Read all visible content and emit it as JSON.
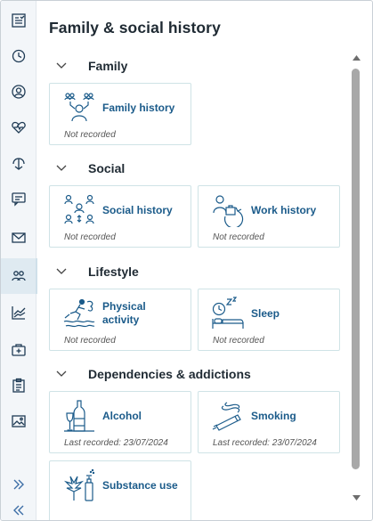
{
  "page": {
    "title": "Family & social history"
  },
  "sections": [
    {
      "label": "Family",
      "cards": [
        {
          "icon": "family-history-icon",
          "title": "Family history",
          "status": "Not recorded"
        }
      ]
    },
    {
      "label": "Social",
      "cards": [
        {
          "icon": "social-history-icon",
          "title": "Social history",
          "status": "Not recorded"
        },
        {
          "icon": "work-history-icon",
          "title": "Work history",
          "status": "Not recorded"
        }
      ]
    },
    {
      "label": "Lifestyle",
      "cards": [
        {
          "icon": "physical-activity-icon",
          "title": "Physical activity",
          "title_line1": "Physical",
          "title_line2": "activity",
          "status": "Not recorded"
        },
        {
          "icon": "sleep-icon",
          "title": "Sleep",
          "status": "Not recorded"
        }
      ]
    },
    {
      "label": "Dependencies & addictions",
      "cards": [
        {
          "icon": "alcohol-icon",
          "title": "Alcohol",
          "status": "Last recorded: 23/07/2024"
        },
        {
          "icon": "smoking-icon",
          "title": "Smoking",
          "status": "Last recorded: 23/07/2024"
        },
        {
          "icon": "substance-use-icon",
          "title": "Substance use",
          "status": ""
        }
      ]
    }
  ],
  "rail": {
    "items": [
      "summary-icon",
      "history-icon",
      "profile-icon",
      "vitals-icon",
      "care-plan-icon",
      "consultation-icon",
      "mail-icon",
      "family-social-icon",
      "chart-icon",
      "medical-kit-icon",
      "clipboard-icon",
      "gallery-icon"
    ],
    "active": "family-social-icon",
    "footer": [
      "expand-icon",
      "collapse-icon"
    ]
  },
  "colors": {
    "accent": "#1b5b8a",
    "card_border": "#cfe3e6",
    "rail_bg": "#f3f6f9",
    "rail_active": "#dfeaf1"
  }
}
